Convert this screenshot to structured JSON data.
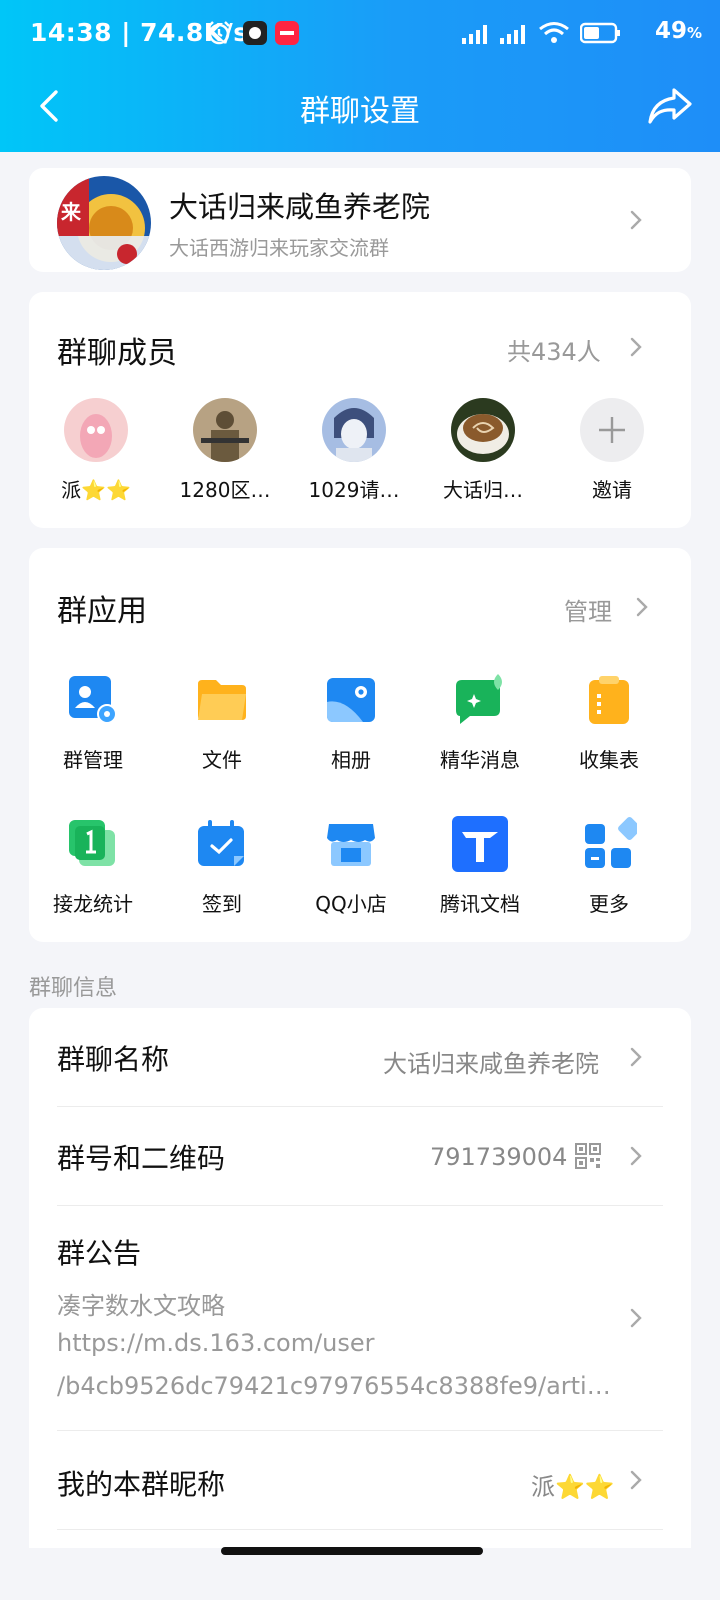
{
  "status": {
    "time": "14:38",
    "speed": "74.8K/s",
    "battery": "49",
    "battery_unit": "%"
  },
  "nav": {
    "title": "群聊设置"
  },
  "group": {
    "name": "大话归来咸鱼养老院",
    "description": "大话西游归来玩家交流群",
    "avatar_text": "来"
  },
  "members": {
    "title": "群聊成员",
    "count": "共434人",
    "list": [
      {
        "name": "派⭐⭐",
        "avatar_color": "#f6cfd0"
      },
      {
        "name": "1280区…",
        "avatar_color": "#8c7a5c"
      },
      {
        "name": "1029请…",
        "avatar_color": "#7f97c4"
      },
      {
        "name": "大话归…",
        "avatar_color": "#8a6a46"
      }
    ],
    "invite_label": "邀请"
  },
  "apps": {
    "title": "群应用",
    "manage_label": "管理",
    "items": [
      {
        "label": "群管理",
        "icon": "group-manage-icon"
      },
      {
        "label": "文件",
        "icon": "folder-icon"
      },
      {
        "label": "相册",
        "icon": "album-icon"
      },
      {
        "label": "精华消息",
        "icon": "essence-message-icon"
      },
      {
        "label": "收集表",
        "icon": "clipboard-icon"
      },
      {
        "label": "接龙统计",
        "icon": "relay-count-icon"
      },
      {
        "label": "签到",
        "icon": "calendar-checkin-icon"
      },
      {
        "label": "QQ小店",
        "icon": "shop-icon"
      },
      {
        "label": "腾讯文档",
        "icon": "tencent-docs-icon"
      },
      {
        "label": "更多",
        "icon": "more-grid-icon"
      }
    ]
  },
  "info": {
    "section_label": "群聊信息",
    "name_title": "群聊名称",
    "name_value": "大话归来咸鱼养老院",
    "number_title": "群号和二维码",
    "number_value": "791739004",
    "notice_title": "群公告",
    "notice_lines": [
      "凑字数水文攻略",
      "https://m.ds.163.com/user",
      "/b4cb9526dc79421c97976554c8388fe9/article…"
    ],
    "nickname_title": "我的本群昵称",
    "nickname_value": "派⭐⭐"
  },
  "colors": {
    "header_start": "#00c6f8",
    "header_end": "#1e8ef8",
    "page_bg": "#f4f5f9",
    "app_blue": "#1e88f2",
    "app_yellow": "#ffb21c",
    "app_green": "#19b35a"
  }
}
